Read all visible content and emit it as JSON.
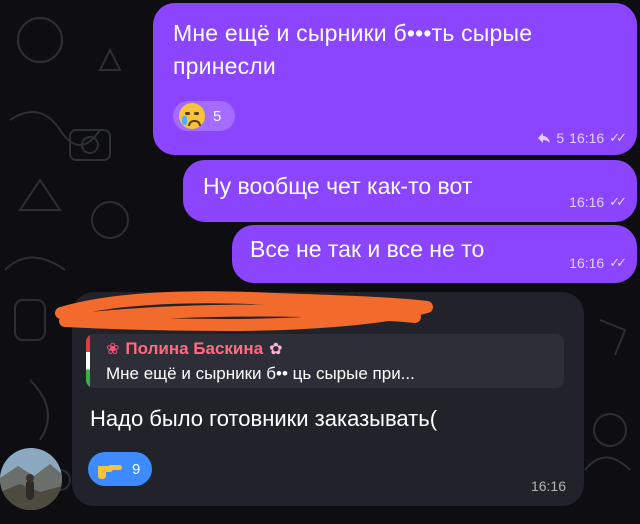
{
  "messages": [
    {
      "text": "Мне ещё и сырники б•••ть сырые принесли",
      "reaction": {
        "icon": "crying-face-icon",
        "count": "5"
      },
      "replies": "5",
      "time": "16:16"
    },
    {
      "text": "Ну вообще чет как-то вот",
      "time": "16:16"
    },
    {
      "text": "Все не так и все не то",
      "time": "16:16"
    }
  ],
  "incoming": {
    "quote_author": "Полина Баскина",
    "quote_text": "Мне ещё и сырники б•• ць сырые при...",
    "text": "Надо было готовники заказывать(",
    "reaction": {
      "icon": "pointing-hand-icon",
      "count": "9"
    },
    "time": "16:16"
  },
  "colors": {
    "outgoing": "#8b45ff",
    "incoming": "#22222a",
    "quote_name": "#ff6b7f",
    "reaction_incoming": "#3d8bff",
    "scribble": "#f26b2d"
  }
}
